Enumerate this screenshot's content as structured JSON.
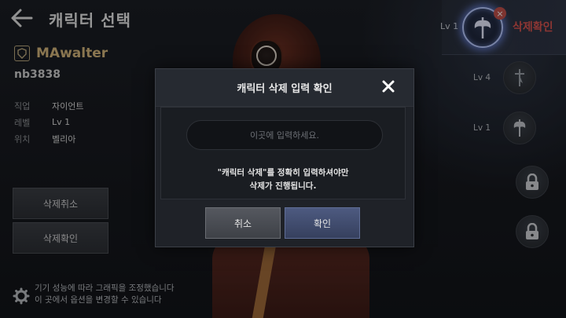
{
  "header": {
    "title": "캐릭터 선택",
    "back_icon": "arrow-left-icon"
  },
  "character": {
    "name": "MAwalter",
    "account": "nb3838",
    "info": [
      {
        "label": "직업",
        "value": "자이언트"
      },
      {
        "label": "레벨",
        "value": "Lv 1"
      },
      {
        "label": "위치",
        "value": "벨리아"
      }
    ]
  },
  "actions": {
    "cancel_delete": "삭제취소",
    "confirm_delete": "삭제확인"
  },
  "settings_notice": {
    "line1": "기기 성능에 따라 그래픽을 조정했습니다",
    "line2": "이 곳에서 옵션을 변경할 수 있습니다"
  },
  "slots": {
    "active": {
      "level": "Lv 1",
      "status": "삭제확인",
      "badge": "×"
    },
    "others": [
      {
        "level": "Lv 4",
        "icon": "sword-icon"
      },
      {
        "level": "Lv 1",
        "icon": "axe-icon"
      },
      {
        "level": "",
        "icon": "lock-icon"
      },
      {
        "level": "",
        "icon": "lock-icon"
      }
    ]
  },
  "modal": {
    "title": "캐릭터 삭제 입력 확인",
    "input_placeholder": "이곳에 입력하세요.",
    "message_line1": "\"캐릭터 삭제\"를 정확히 입력하셔야만",
    "message_line2": "삭제가 진행됩니다.",
    "cancel_label": "취소",
    "confirm_label": "확인"
  },
  "colors": {
    "accent_red": "#d9534f",
    "name_gold": "#d4b67c",
    "confirm_blue": "#36405e"
  }
}
